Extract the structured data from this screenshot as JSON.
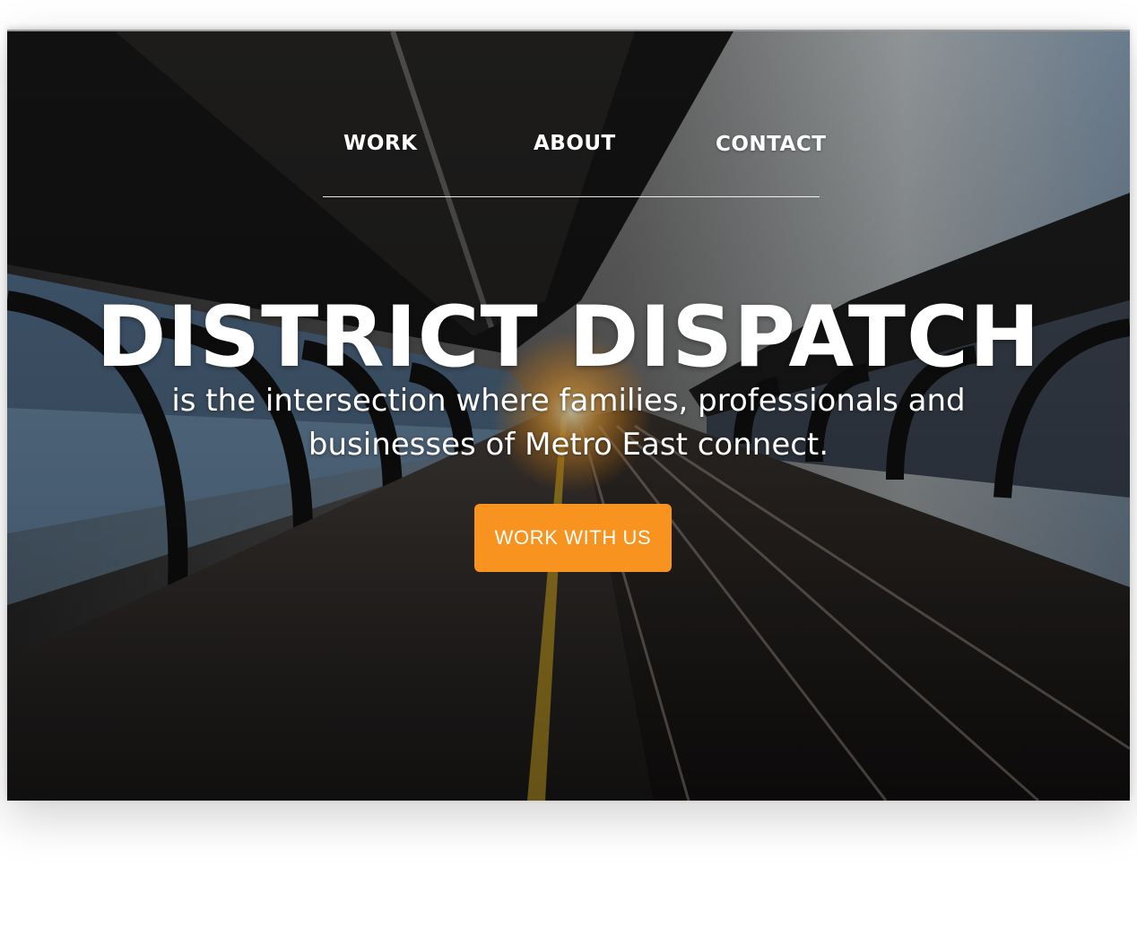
{
  "nav": {
    "items": [
      {
        "label": "WORK"
      },
      {
        "label": "ABOUT"
      },
      {
        "label": "CONTACT"
      }
    ]
  },
  "hero": {
    "title": "DISTRICT DISPATCH",
    "tagline": "is the intersection where families, professionals and businesses of Metro East connect.",
    "cta_label": "WORK WITH US",
    "background_image": "train-station-platform-sunset-photo"
  },
  "colors": {
    "accent": "#f7931e",
    "text": "#ffffff"
  }
}
